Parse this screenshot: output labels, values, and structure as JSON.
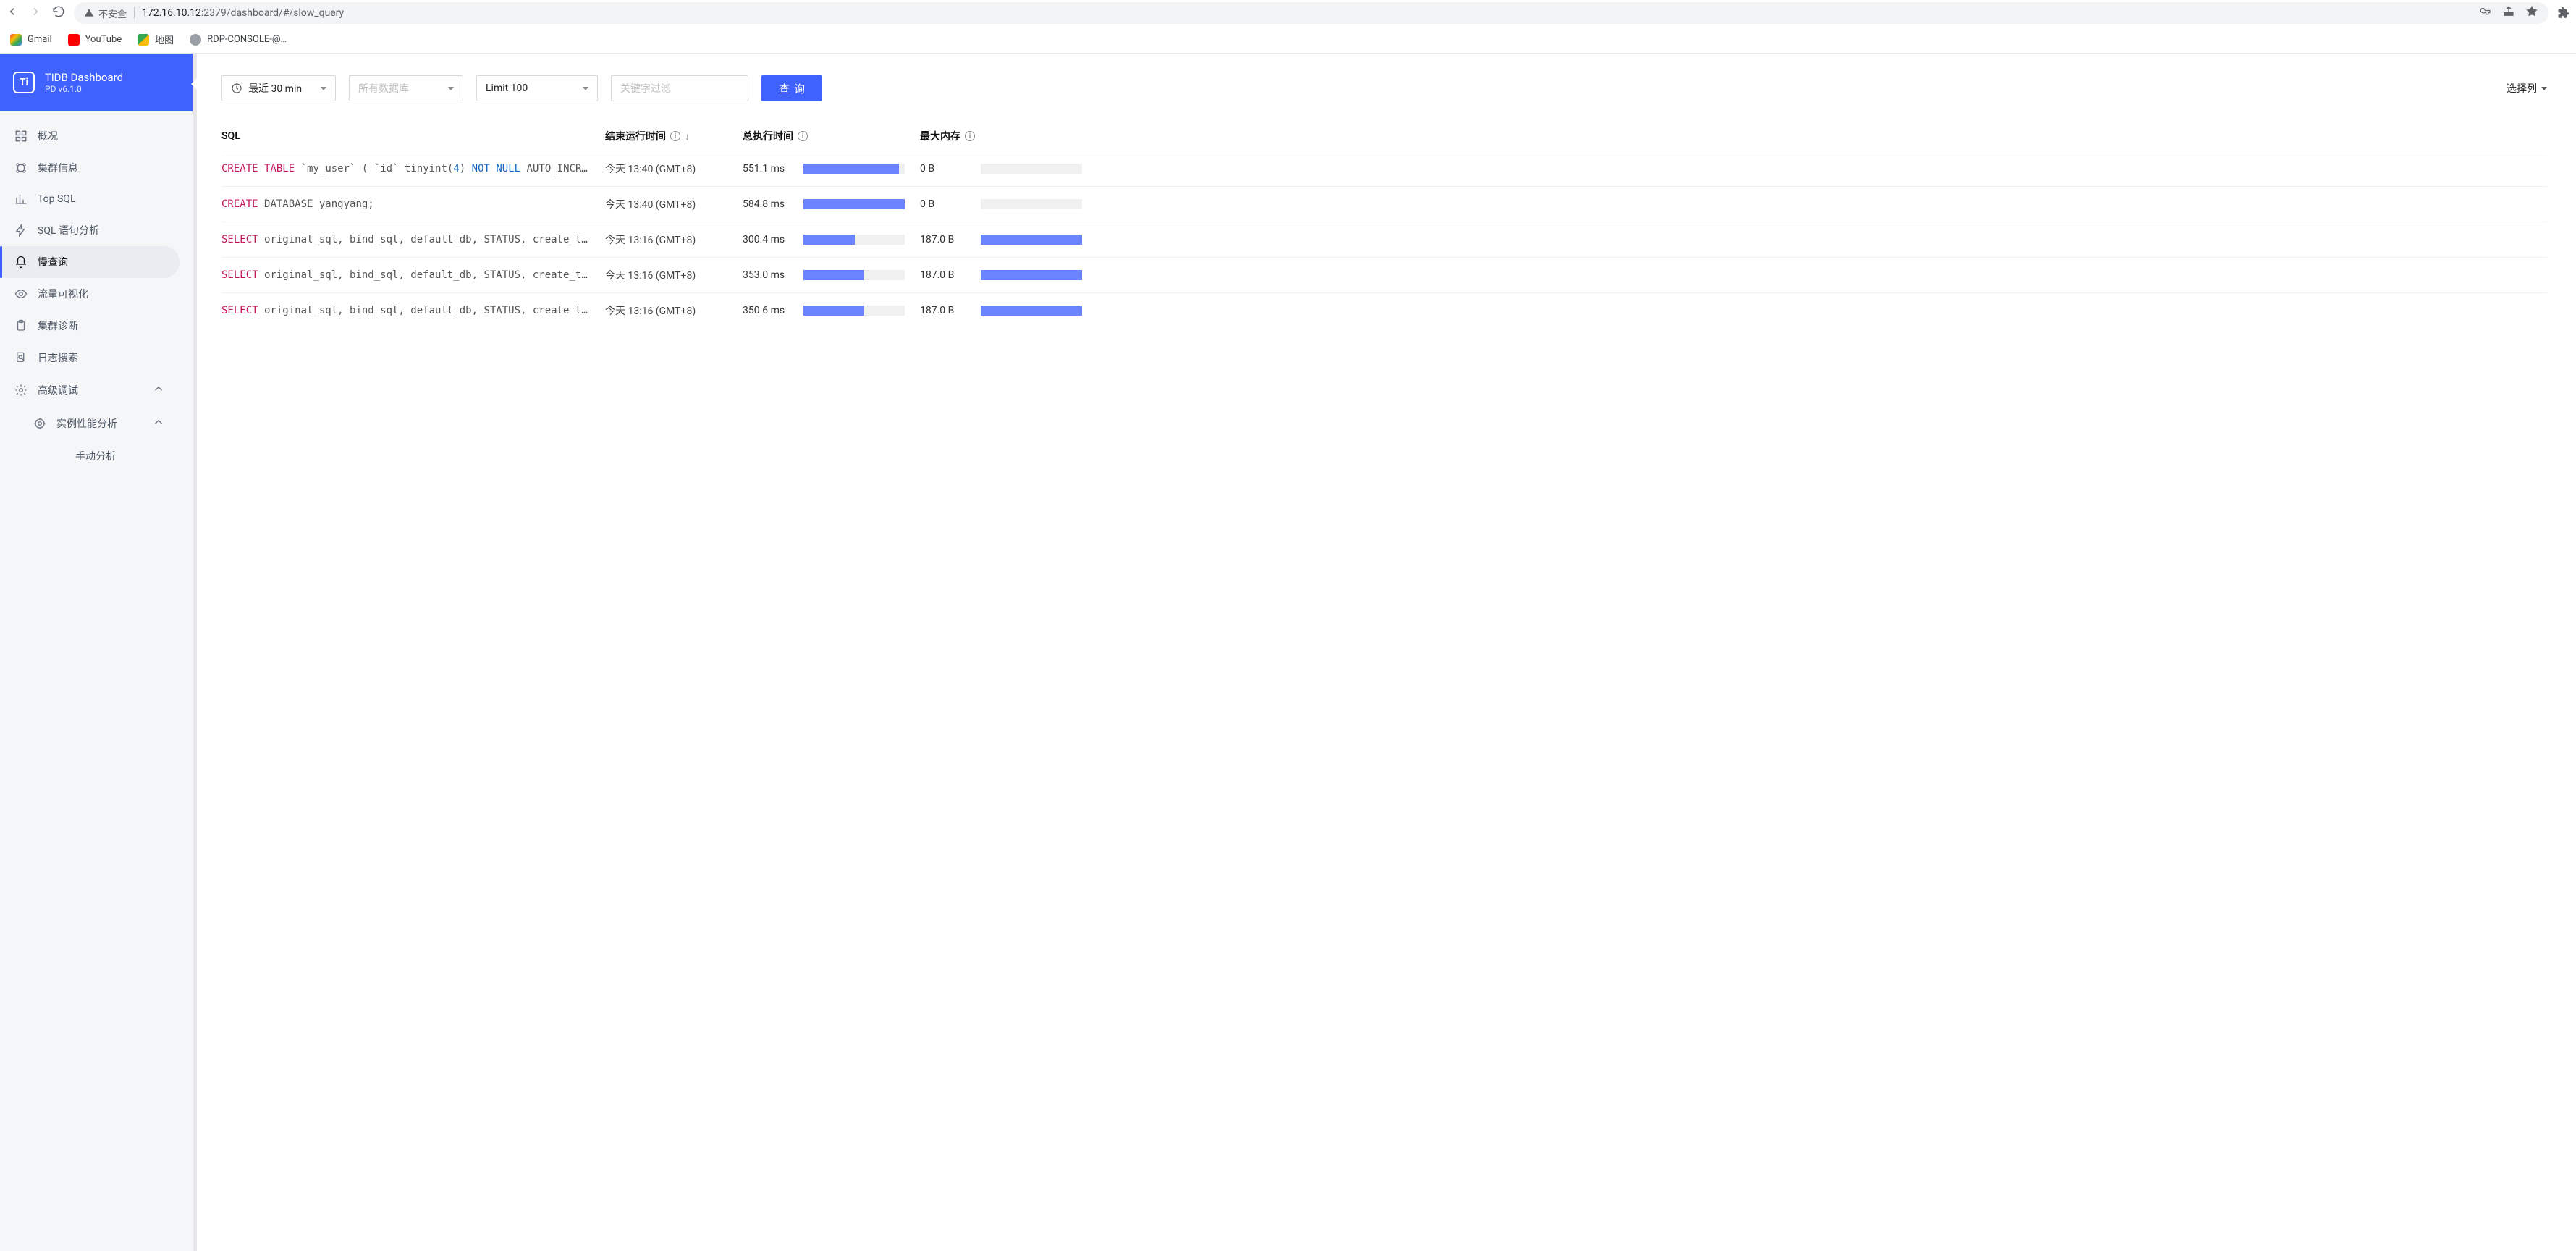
{
  "chrome": {
    "insecure_label": "不安全",
    "url_host": "172.16.10.12",
    "url_port_path": ":2379/dashboard/#/slow_query"
  },
  "bookmarks": [
    {
      "label": "Gmail",
      "icon": "gmail"
    },
    {
      "label": "YouTube",
      "icon": "youtube"
    },
    {
      "label": "地图",
      "icon": "maps"
    },
    {
      "label": "RDP-CONSOLE-@…",
      "icon": "rdp"
    }
  ],
  "brand": {
    "title": "TiDB Dashboard",
    "subtitle": "PD v6.1.0"
  },
  "nav": [
    {
      "id": "overview",
      "label": "概况",
      "icon": "grid"
    },
    {
      "id": "cluster",
      "label": "集群信息",
      "icon": "nodes"
    },
    {
      "id": "topsql",
      "label": "Top SQL",
      "icon": "bars"
    },
    {
      "id": "sqlanalysis",
      "label": "SQL 语句分析",
      "icon": "bolt"
    },
    {
      "id": "slowquery",
      "label": "慢查询",
      "icon": "bell",
      "active": true
    },
    {
      "id": "traffic",
      "label": "流量可视化",
      "icon": "eye"
    },
    {
      "id": "diagnosis",
      "label": "集群诊断",
      "icon": "clipboard"
    },
    {
      "id": "logsearch",
      "label": "日志搜索",
      "icon": "search-doc"
    },
    {
      "id": "advanced",
      "label": "高级调试",
      "icon": "gear",
      "expandable": true,
      "expanded": true
    },
    {
      "id": "profiling",
      "label": "实例性能分析",
      "icon": "target",
      "indent": 1,
      "expandable": true,
      "expanded": true
    },
    {
      "id": "manual",
      "label": "手动分析",
      "icon": "",
      "indent": 2
    }
  ],
  "toolbar": {
    "time_range": "最近 30 min",
    "db_placeholder": "所有数据库",
    "limit": "Limit 100",
    "keyword_placeholder": "关键字过滤",
    "query_btn": "查询",
    "columns_btn": "选择列"
  },
  "columns": {
    "sql": "SQL",
    "end_time": "结束运行时间",
    "total_time": "总执行时间",
    "max_mem": "最大内存"
  },
  "rows": [
    {
      "sql_tokens": [
        {
          "t": "kw",
          "v": "CREATE"
        },
        {
          "t": "sp"
        },
        {
          "t": "kw",
          "v": "TABLE"
        },
        {
          "t": "sp"
        },
        {
          "t": "str",
          "v": "`my_user`"
        },
        {
          "t": "sp"
        },
        {
          "t": "str",
          "v": "( `id` tinyint("
        },
        {
          "t": "num",
          "v": "4"
        },
        {
          "t": "str",
          "v": ") "
        },
        {
          "t": "kw2",
          "v": "NOT"
        },
        {
          "t": "sp"
        },
        {
          "t": "kw2",
          "v": "NULL"
        },
        {
          "t": "sp"
        },
        {
          "t": "str",
          "v": "AUTO_INCRE…"
        }
      ],
      "end_time": "今天 13:40 (GMT+8)",
      "total_time": "551.1 ms",
      "time_pct": 94,
      "max_mem": "0 B",
      "mem_pct": 0
    },
    {
      "sql_tokens": [
        {
          "t": "kw",
          "v": "CREATE"
        },
        {
          "t": "sp"
        },
        {
          "t": "str",
          "v": "DATABASE yangyang;"
        }
      ],
      "end_time": "今天 13:40 (GMT+8)",
      "total_time": "584.8 ms",
      "time_pct": 100,
      "max_mem": "0 B",
      "mem_pct": 0
    },
    {
      "sql_tokens": [
        {
          "t": "kw",
          "v": "SELECT"
        },
        {
          "t": "sp"
        },
        {
          "t": "str",
          "v": "original_sql, bind_sql, default_db, STATUS, create_ti…"
        }
      ],
      "end_time": "今天 13:16 (GMT+8)",
      "total_time": "300.4 ms",
      "time_pct": 51,
      "max_mem": "187.0 B",
      "mem_pct": 100
    },
    {
      "sql_tokens": [
        {
          "t": "kw",
          "v": "SELECT"
        },
        {
          "t": "sp"
        },
        {
          "t": "str",
          "v": "original_sql, bind_sql, default_db, STATUS, create_ti…"
        }
      ],
      "end_time": "今天 13:16 (GMT+8)",
      "total_time": "353.0 ms",
      "time_pct": 60,
      "max_mem": "187.0 B",
      "mem_pct": 100
    },
    {
      "sql_tokens": [
        {
          "t": "kw",
          "v": "SELECT"
        },
        {
          "t": "sp"
        },
        {
          "t": "str",
          "v": "original_sql, bind_sql, default_db, STATUS, create_ti…"
        }
      ],
      "end_time": "今天 13:16 (GMT+8)",
      "total_time": "350.6 ms",
      "time_pct": 60,
      "max_mem": "187.0 B",
      "mem_pct": 100
    }
  ]
}
